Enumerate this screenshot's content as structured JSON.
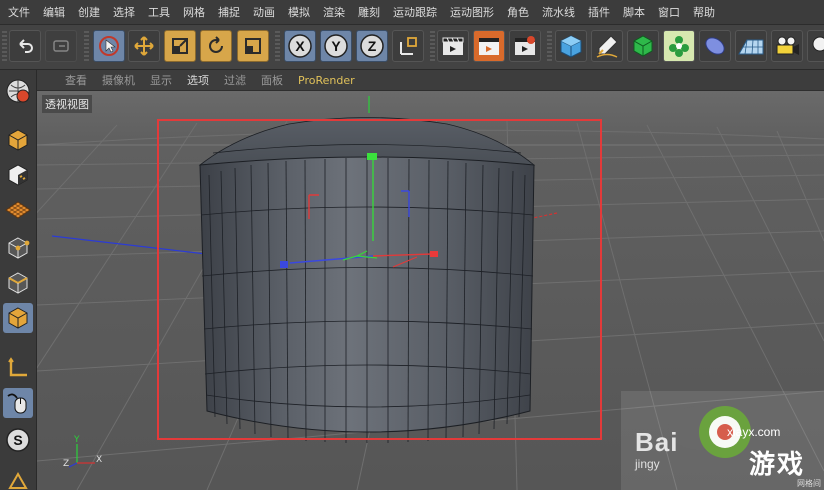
{
  "menu": [
    "文件",
    "编辑",
    "创建",
    "选择",
    "工具",
    "网格",
    "捕捉",
    "动画",
    "模拟",
    "渲染",
    "雕刻",
    "运动跟踪",
    "运动图形",
    "角色",
    "流水线",
    "插件",
    "脚本",
    "窗口",
    "帮助"
  ],
  "toolbar": {
    "undo": "undo-icon",
    "redo": "redo-icon",
    "axis_x": "X",
    "axis_y": "Y",
    "axis_z": "Z"
  },
  "viewport_menu": [
    "查看",
    "摄像机",
    "显示",
    "选项",
    "过滤",
    "面板",
    "ProRender"
  ],
  "viewport_active": "选项",
  "viewport_name": "透视视图",
  "axis_labels": {
    "x": "X",
    "y": "Y",
    "z": "Z"
  },
  "corner_text": "网格间",
  "watermark": {
    "baidu": "Bai",
    "jingyan": "jingy",
    "site": "xiayx.com",
    "game": "游戏"
  },
  "colors": {
    "selection_frame": "#e33a3a",
    "accent_orange": "#d7a64a",
    "accent_blue": "#6e86a8"
  }
}
